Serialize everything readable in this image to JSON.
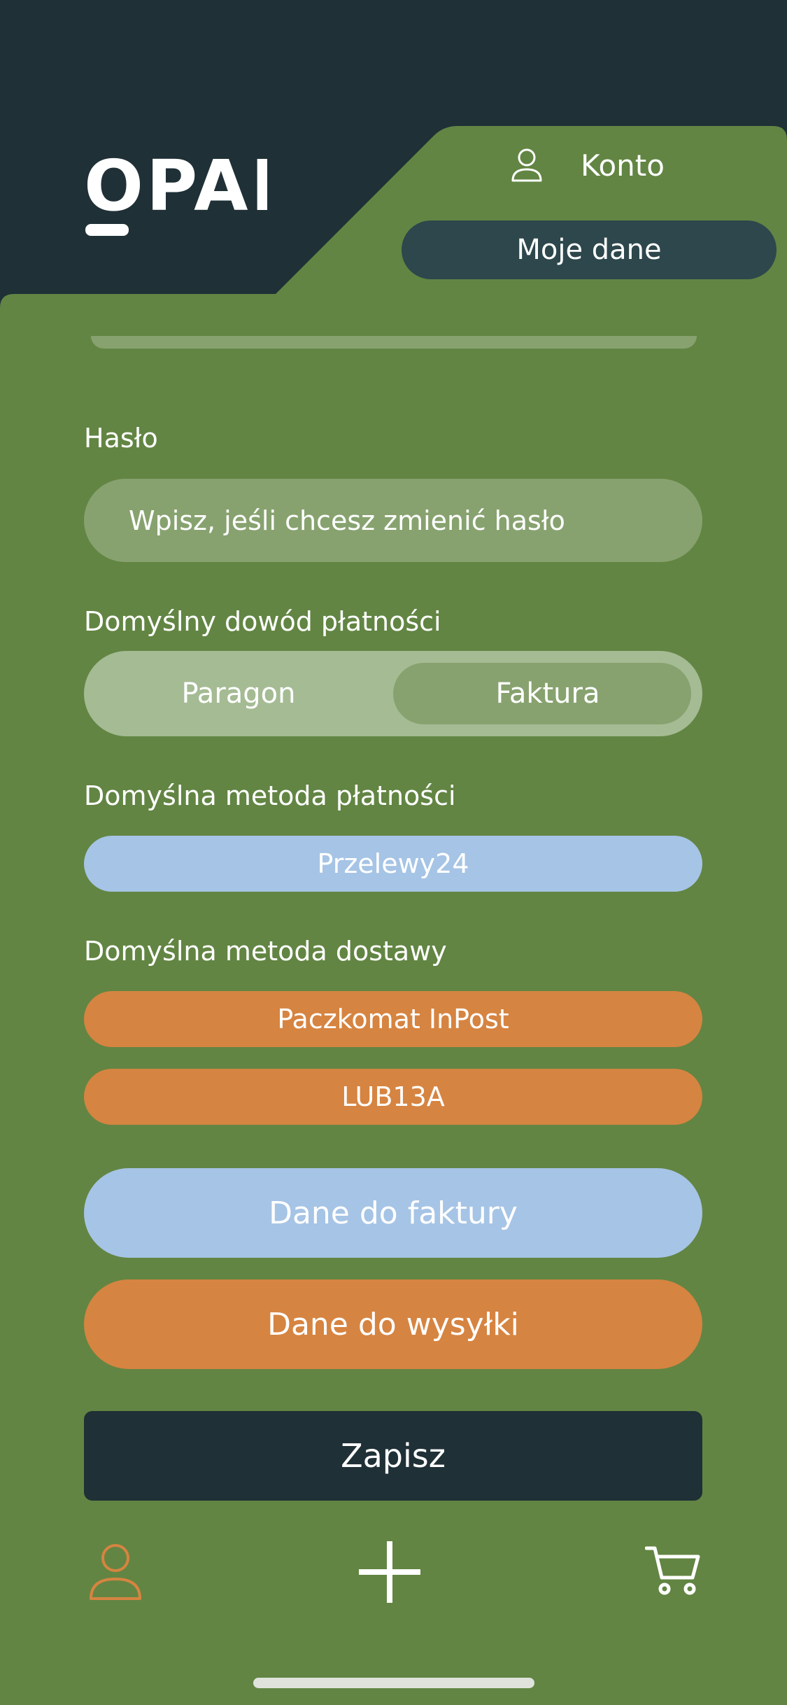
{
  "header": {
    "logo_text": "OPAL",
    "account_label": "Konto",
    "account_icon": "user-icon",
    "section_title": "Moje dane"
  },
  "form": {
    "password": {
      "label": "Hasło",
      "placeholder": "Wpisz, jeśli chcesz zmienić hasło",
      "value": ""
    },
    "payment_proof": {
      "label": "Domyślny dowód płatności",
      "options": [
        "Paragon",
        "Faktura"
      ],
      "selected": "Faktura"
    },
    "payment_method": {
      "label": "Domyślna metoda płatności",
      "value": "Przelewy24"
    },
    "delivery_method": {
      "label": "Domyślna metoda dostawy",
      "value": "Paczkomat InPost",
      "locker_code": "LUB13A"
    },
    "invoice_data_label": "Dane do faktury",
    "shipping_data_label": "Dane do wysyłki",
    "save_label": "Zapisz"
  },
  "tabbar": {
    "items": [
      {
        "icon": "user-icon",
        "active": true
      },
      {
        "icon": "plus-icon",
        "active": false
      },
      {
        "icon": "cart-icon",
        "active": false
      }
    ]
  },
  "colors": {
    "dark": "#1f3036",
    "green": "#628543",
    "pill_dark": "#2d474c",
    "input_green": "#87a26f",
    "segment_bg": "#a5bb94",
    "blue": "#a6c4e5",
    "orange": "#d68441"
  }
}
